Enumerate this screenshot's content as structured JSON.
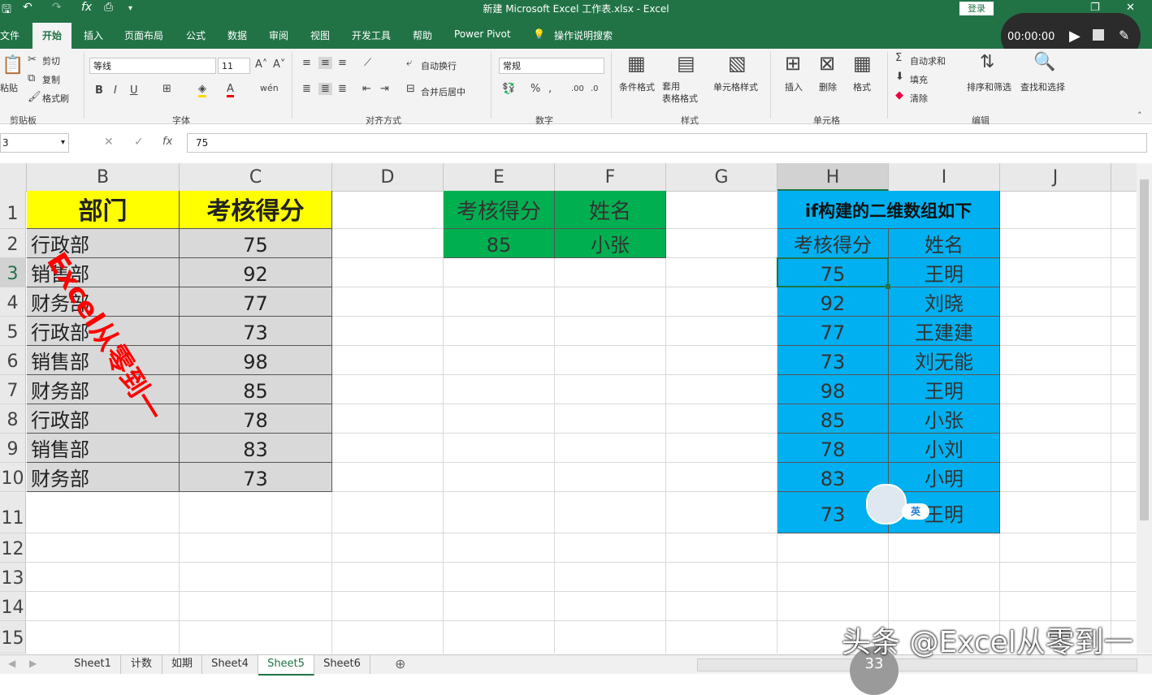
{
  "window": {
    "title": "新建 Microsoft Excel 工作表.xlsx  -  Excel",
    "login_label": "登录"
  },
  "tabs": [
    "文件",
    "开始",
    "插入",
    "页面布局",
    "公式",
    "数据",
    "审阅",
    "视图",
    "开发工具",
    "帮助",
    "Power Pivot",
    "操作说明搜索"
  ],
  "active_tab": "开始",
  "ribbon": {
    "clipboard": {
      "paste": "粘贴",
      "cut": "剪切",
      "copy": "复制",
      "format_painter": "格式刷",
      "group": "剪贴板"
    },
    "font": {
      "name": "等线",
      "size": "11",
      "group": "字体"
    },
    "alignment": {
      "wrap": "自动换行",
      "merge": "合并后居中",
      "group": "对齐方式"
    },
    "number": {
      "format": "常规",
      "group": "数字"
    },
    "styles": {
      "conditional": "条件格式",
      "table": "套用\n表格格式",
      "cell_styles": "单元格样式",
      "group": "样式"
    },
    "cells": {
      "insert": "插入",
      "delete": "删除",
      "format": "格式",
      "group": "单元格"
    },
    "editing": {
      "autosum": "自动求和",
      "fill": "填充",
      "clear": "清除",
      "sort": "排序和筛选",
      "find": "查找和选择",
      "group": "编辑"
    }
  },
  "recorder": {
    "time": "00:00:00"
  },
  "formula_bar": {
    "name_box": "3",
    "value": "75"
  },
  "columns": [
    "B",
    "C",
    "D",
    "E",
    "F",
    "G",
    "H",
    "I",
    "J"
  ],
  "rows": [
    "1",
    "2",
    "3",
    "4",
    "5",
    "6",
    "7",
    "8",
    "9",
    "10",
    "11",
    "12",
    "13",
    "14",
    "15"
  ],
  "table_left": {
    "headers": [
      "部门",
      "考核得分"
    ],
    "rows": [
      [
        "行政部",
        "75"
      ],
      [
        "销售部",
        "92"
      ],
      [
        "财务部",
        "77"
      ],
      [
        "行政部",
        "73"
      ],
      [
        "销售部",
        "98"
      ],
      [
        "财务部",
        "85"
      ],
      [
        "行政部",
        "78"
      ],
      [
        "销售部",
        "83"
      ],
      [
        "财务部",
        "73"
      ]
    ]
  },
  "table_mid": {
    "headers": [
      "考核得分",
      "姓名"
    ],
    "row": [
      "85",
      "小张"
    ]
  },
  "table_right": {
    "title": "if构建的二维数组如下",
    "headers": [
      "考核得分",
      "姓名"
    ],
    "rows": [
      [
        "75",
        "王明"
      ],
      [
        "92",
        "刘晓"
      ],
      [
        "77",
        "王建建"
      ],
      [
        "73",
        "刘无能"
      ],
      [
        "98",
        "王明"
      ],
      [
        "85",
        "小张"
      ],
      [
        "78",
        "小刘"
      ],
      [
        "83",
        "小明"
      ],
      [
        "73",
        "王明"
      ]
    ]
  },
  "watermark": "Excel从零到一",
  "brand_overlay": "头条 @Excel从零到一",
  "ime_badge": "英",
  "zoom_badge": "33",
  "sheets": [
    "Sheet1",
    "计数",
    "如期",
    "Sheet4",
    "Sheet5",
    "Sheet6"
  ],
  "active_sheet": "Sheet5"
}
